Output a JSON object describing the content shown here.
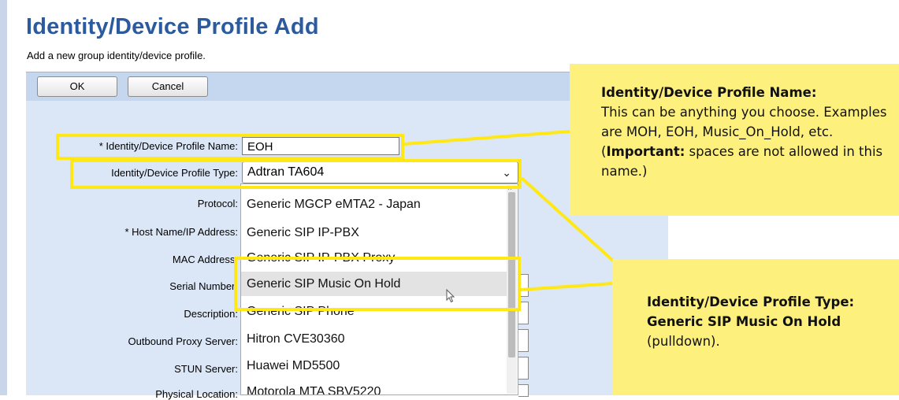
{
  "page": {
    "title": "Identity/Device Profile Add",
    "description": "Add a new group identity/device profile."
  },
  "toolbar": {
    "ok_label": "OK",
    "cancel_label": "Cancel"
  },
  "form": {
    "name_label": "* Identity/Device Profile Name:",
    "name_value": "EOH",
    "type_label": "Identity/Device Profile Type:",
    "type_value": "Adtran TA604",
    "protocol_label": "Protocol:",
    "host_label": "* Host Name/IP Address:",
    "mac_label": "MAC Address:",
    "serial_label": "Serial Number:",
    "description_label": "Description:",
    "outbound_label": "Outbound Proxy Server:",
    "stun_label": "STUN Server:",
    "location_label": "Physical Location:"
  },
  "dropdown": {
    "options": [
      "Generic MGCP eMTA2 - Japan",
      "Generic SIP IP-PBX",
      "Generic SIP IP-PBX Proxy",
      "Generic SIP Music On Hold",
      "Generic SIP Phone",
      "Hitron CVE30360",
      "Huawei MD5500",
      "Motorola MTA SBV5220"
    ],
    "highlighted": "Generic SIP Music On Hold"
  },
  "callouts": {
    "name": {
      "heading": "Identity/Device Profile Name:",
      "text": "This can be anything you choose. Examples are MOH, EOH, Music_On_Hold, etc. (",
      "important": "Important:",
      "text_end": " spaces are not allowed in this name.)"
    },
    "type": {
      "heading": "Identity/Device Profile Type: Generic SIP Music On Hold",
      "text": " (pulldown)."
    }
  },
  "colors": {
    "title": "#2c5a9e",
    "callout_bg": "#fdf07d",
    "highlight_border": "#ffe816",
    "panel_bg": "#dbe7f6"
  }
}
